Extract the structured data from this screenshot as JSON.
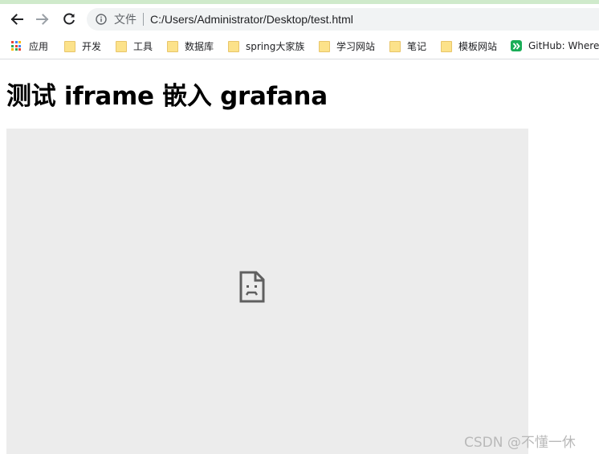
{
  "browser": {
    "nav": {
      "back": "back-arrow-icon",
      "forward": "forward-arrow-icon",
      "reload": "reload-icon"
    },
    "omnibox": {
      "scheme_label": "文件",
      "url": "C:/Users/Administrator/Desktop/test.html",
      "info_icon": "info-icon"
    }
  },
  "bookmarks": [
    {
      "label": "应用",
      "icon": "apps-grid-icon"
    },
    {
      "label": "开发",
      "icon": "folder-icon"
    },
    {
      "label": "工具",
      "icon": "folder-icon"
    },
    {
      "label": "数据库",
      "icon": "folder-icon"
    },
    {
      "label": "spring大家族",
      "icon": "folder-icon"
    },
    {
      "label": "学习网站",
      "icon": "folder-icon"
    },
    {
      "label": "笔记",
      "icon": "folder-icon"
    },
    {
      "label": "模板网站",
      "icon": "folder-icon"
    },
    {
      "label": "GitHub: Where",
      "icon": "github-favicon-icon"
    }
  ],
  "page": {
    "title": "测试 iframe 嵌入 grafana",
    "iframe_icon": "sad-page-icon"
  },
  "watermark": "CSDN @不懂一休",
  "colors": {
    "top_stripe": "#cfeacb",
    "iframe_bg": "#ececec",
    "folder": "#fce28a",
    "github_green": "#1aad57"
  }
}
